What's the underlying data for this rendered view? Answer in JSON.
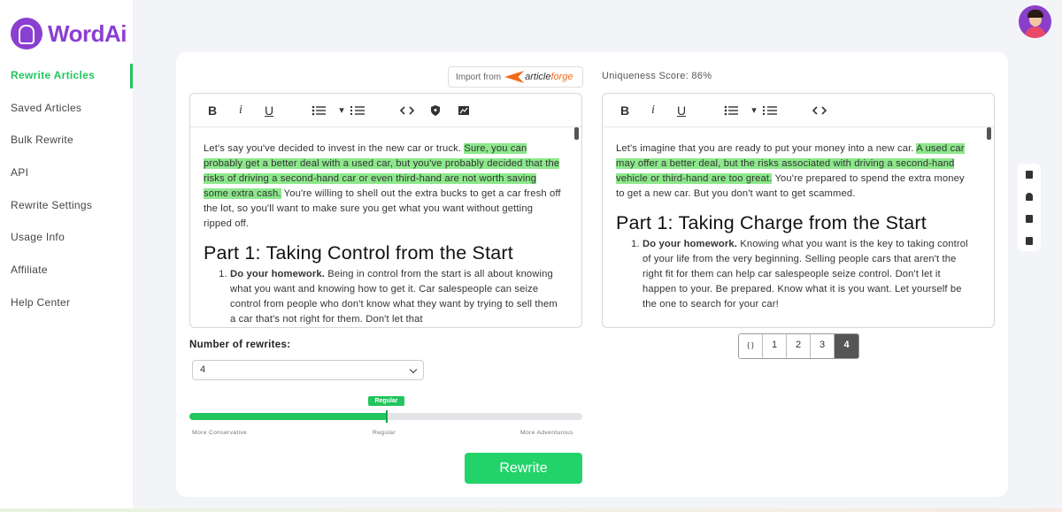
{
  "brand": {
    "name": "WordAi"
  },
  "sidebar": {
    "items": [
      {
        "label": "Rewrite Articles"
      },
      {
        "label": "Saved Articles"
      },
      {
        "label": "Bulk Rewrite"
      },
      {
        "label": "API"
      },
      {
        "label": "Rewrite Settings"
      },
      {
        "label": "Usage Info"
      },
      {
        "label": "Affiliate"
      },
      {
        "label": "Help Center"
      }
    ],
    "active_index": 0
  },
  "import": {
    "prefix": "Import from",
    "article": "article",
    "forge": "forge"
  },
  "uniqueness": {
    "text": "Uniqueness Score: 86%"
  },
  "left_editor": {
    "p1_a": "Let's say you've decided to invest in the new car or truck. ",
    "p1_hl": "Sure, you can probably get a better deal with a used car, but you've probably decided that the risks of driving a second-hand car or even third-hand are not worth saving some extra cash.",
    "p1_b": " You're willing to shell out the extra bucks to get a car fresh off the lot, so you'll want to make sure you get what you want without getting ripped off.",
    "heading": "Part 1: Taking Control from the Start",
    "li_bold": "Do your homework.",
    "li_text": " Being in control from the start is all about knowing what you want and knowing how to get it. Car salespeople can seize control from people who don't know what they want by trying to sell them a car that's not right for them. Don't let that"
  },
  "right_editor": {
    "p1_a": "Let's imagine that you are ready to put your money into a new car. ",
    "p1_hl": "A used car may offer a better deal, but the risks associated with driving a second-hand vehicle or third-hand are too great.",
    "p1_b": " You're prepared to spend the extra money to get a new car. But you don't want to get scammed.",
    "heading": "Part 1: Taking Charge from the Start",
    "li_bold": "Do your homework.",
    "li_text": " Knowing what you want is the key to taking control of your life from the very beginning. Selling people cars that aren't the right fit for them can help car salespeople seize control. Don't let it happen to your. Be prepared. Know what it is you want. Let yourself be the one to search for your car!"
  },
  "rewrites": {
    "label": "Number of rewrites:",
    "selected": "4"
  },
  "slider": {
    "badge": "Regular",
    "value": 0.5,
    "min_label": "More Conservative",
    "mid_label": "Regular",
    "max_label": "More Adventurous"
  },
  "rewrite_button": {
    "label": "Rewrite"
  },
  "pager": {
    "items": [
      "{ }",
      "1",
      "2",
      "3",
      "4"
    ],
    "active_index": 4
  },
  "toolbar_icons": [
    "bold-icon",
    "italic-icon",
    "underline-icon",
    "bullet-list-icon",
    "numbered-list-icon",
    "code-icon",
    "shield-icon",
    "image-icon"
  ],
  "colors": {
    "accent": "#22c55e",
    "brand": "#8b3fd1",
    "highlight": "#8de88c"
  }
}
